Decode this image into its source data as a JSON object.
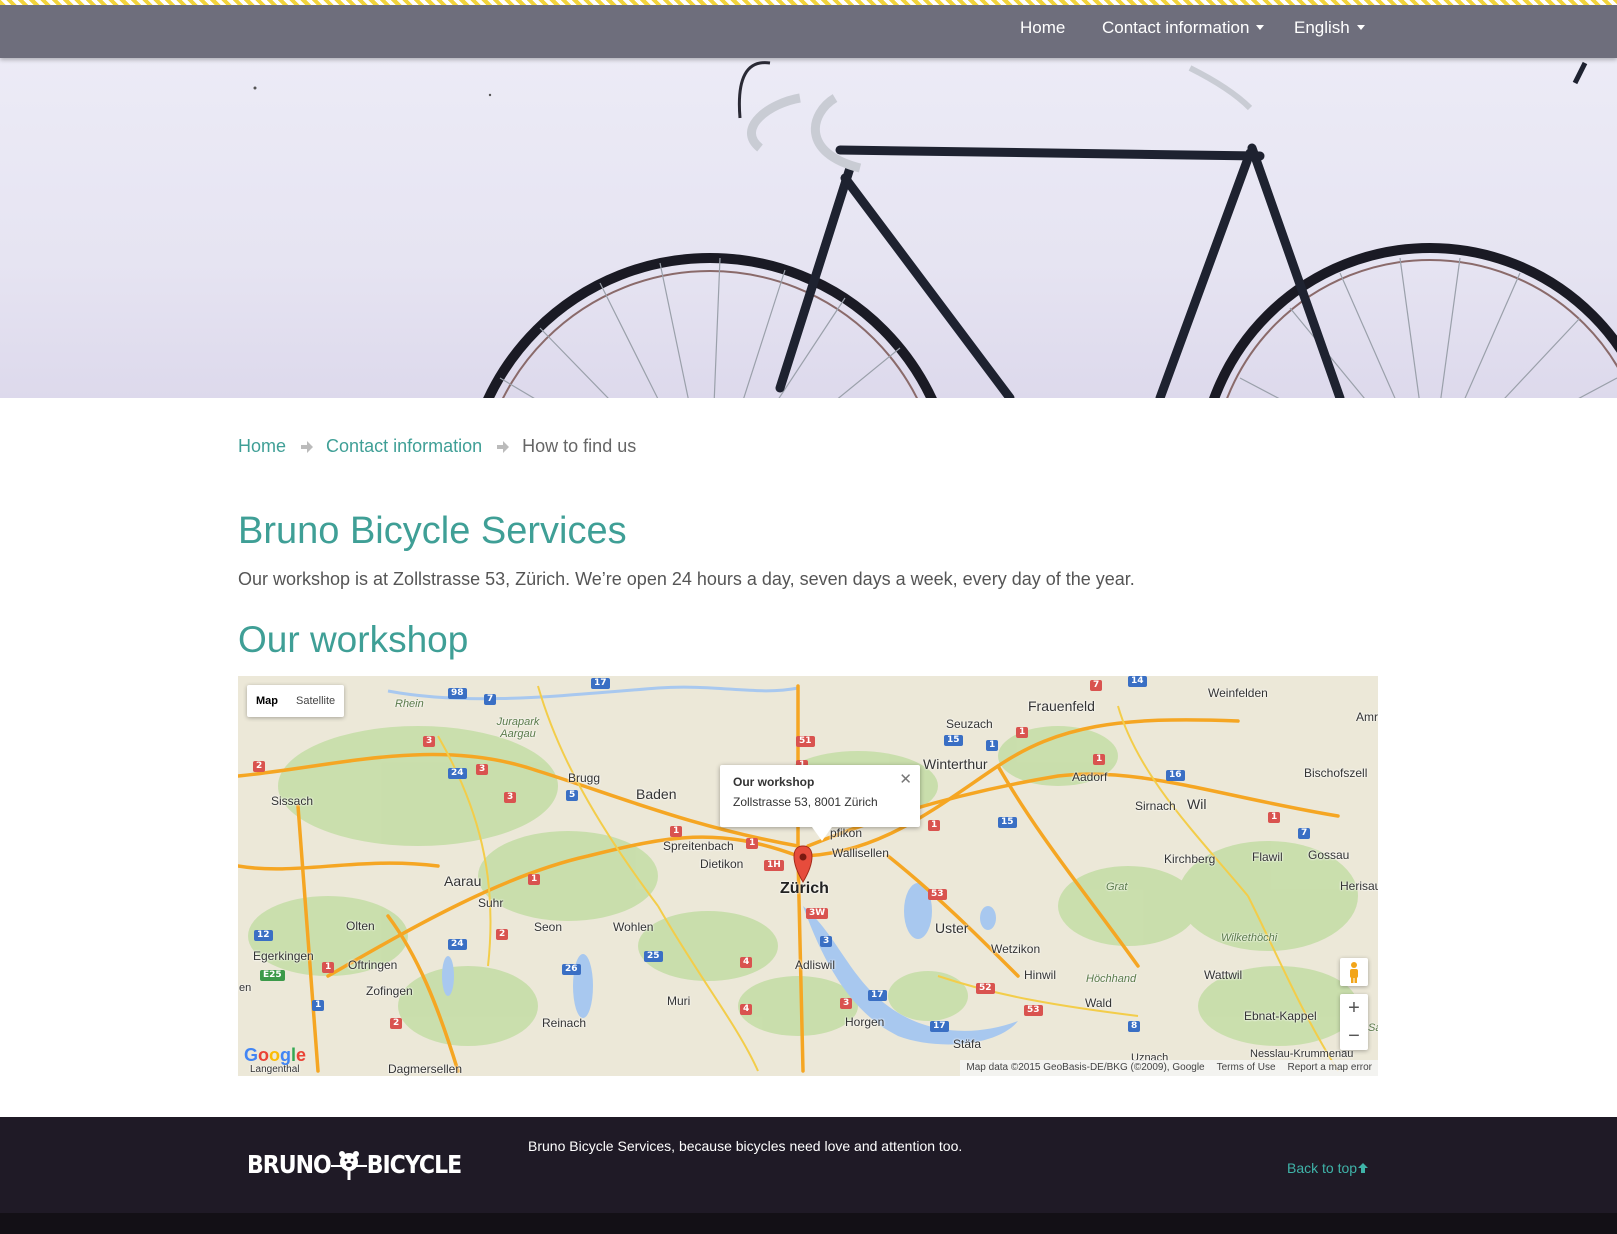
{
  "nav": {
    "home": "Home",
    "contact": "Contact information",
    "language": "English"
  },
  "breadcrumb": {
    "home": "Home",
    "contact": "Contact information",
    "current": "How to find us"
  },
  "main": {
    "title": "Bruno Bicycle Services",
    "intro": "Our workshop is at Zollstrasse 53, Zürich. We’re open 24 hours a day, seven days a week, every day of the year.",
    "section_title": "Our workshop"
  },
  "map": {
    "type_map": "Map",
    "type_satellite": "Satellite",
    "info_title": "Our workshop",
    "info_address": "Zollstrasse 53, 8001 Zürich",
    "zoom_in": "+",
    "zoom_out": "−",
    "logo": "Google",
    "attribution": "Map data ©2015 GeoBasis-DE/BKG (©2009), Google",
    "terms": "Terms of Use",
    "report": "Report a map error",
    "places": {
      "zurich": "Zürich",
      "winterthur": "Winterthur",
      "frauenfeld": "Frauenfeld",
      "weinfelden": "Weinfelden",
      "seuzach": "Seuzach",
      "baden": "Baden",
      "brugg": "Brugg",
      "aarau": "Aarau",
      "sissach": "Sissach",
      "rhein": "Rhein",
      "jurapark": "Jurapark Aargau",
      "spreitenbach": "Spreitenbach",
      "dietikon": "Dietikon",
      "wallisellen": "Wallisellen",
      "kloten": "pfikon",
      "uster": "Uster",
      "wetzikon": "Wetzikon",
      "hinwil": "Hinwil",
      "wald": "Wald",
      "horgen": "Horgen",
      "staefa": "Stäfa",
      "adliswil": "Adliswil",
      "suhr": "Suhr",
      "seon": "Seon",
      "wohlen": "Wohlen",
      "muri": "Muri",
      "reinach": "Reinach",
      "olten": "Olten",
      "oftringen": "Oftringen",
      "zofingen": "Zofingen",
      "egerkingen": "Egerkingen",
      "dagmersellen": "Dagmersellen",
      "langenthal": "Langenthal",
      "sirnach": "Sirnach",
      "wil": "Wil",
      "aadorf": "Aadorf",
      "kirchberg": "Kirchberg",
      "flawil": "Flawil",
      "gossau": "Gossau",
      "herisau": "Herisau",
      "bischofszell": "Bischofszell",
      "amriswil": "Amri",
      "grat": "Grat",
      "wilkethoechi": "Wilkethöchi",
      "hoechhand": "Höchhand",
      "wattwil": "Wattwil",
      "ebnat": "Ebnat-Kappel",
      "nesslau": "Nesslau-Krummenau",
      "uznach": "Uznach",
      "en": "en",
      "sa": "Sa"
    }
  },
  "footer": {
    "logo_left": "BRUNO",
    "logo_right": "BICYCLE",
    "tagline": "Bruno Bicycle Services, because bicycles need love and attention too.",
    "back_to_top": "Back to top"
  },
  "colors": {
    "accent": "#3f9f96",
    "navbar": "#6e6e7c",
    "footer": "#1f1a26",
    "stripe": "#f2d43b"
  }
}
